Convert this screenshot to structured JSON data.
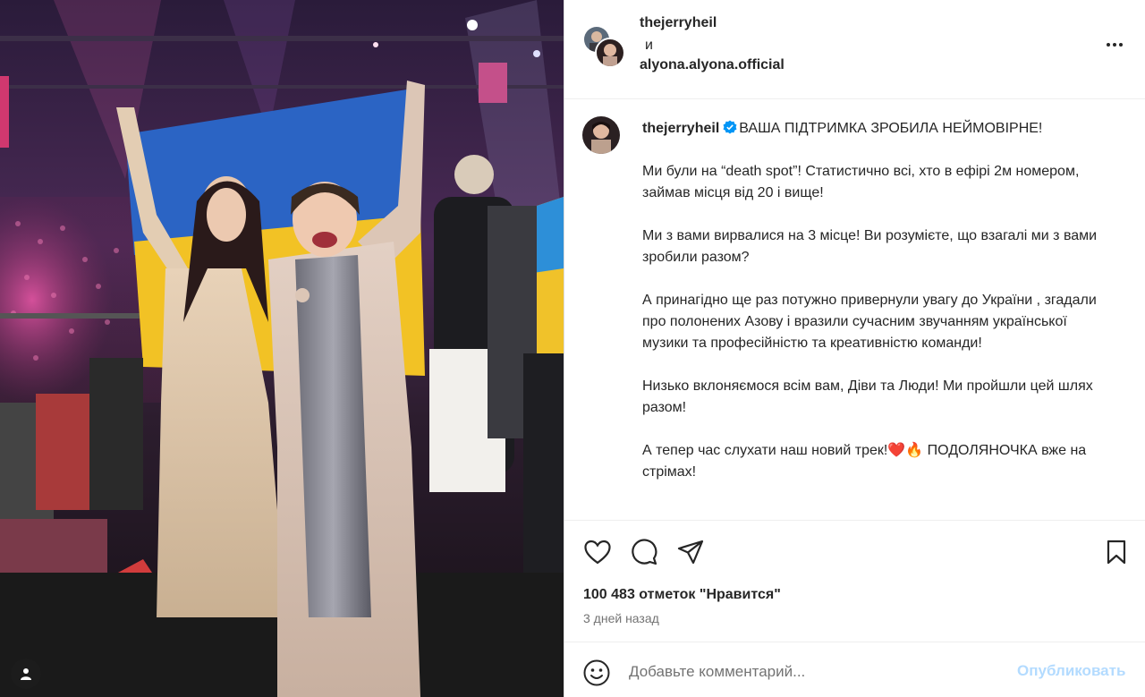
{
  "post": {
    "author": "thejerryheil",
    "and": "и",
    "collaborator": "alyona.alyona.official",
    "verified_icon": "verified-badge-icon",
    "more_icon": "more-options-icon"
  },
  "caption": {
    "username": "thejerryheil",
    "headline": "ВАША ПІДТРИМКА ЗРОБИЛА НЕЙМОВІРНЕ!",
    "paragraphs": [
      "Ми були на “death spot”! Статистично всі, хто в ефірі 2м номером, займав місця від 20 і вище!",
      "Ми з вами вирвалися на 3 місце! Ви розумієте, що взагалі ми з вами зробили разом?",
      "А принагідно ще раз потужно привернули увагу до України , згадали про полонених Азову і вразили сучасним звучанням української музики та професійністю та креативністю команди!",
      "Низько вклоняємося всім вам, Діви та Люди! Ми пройшли цей шлях разом!"
    ],
    "last_before": "А тепер час слухати наш новий трек!",
    "last_emojis": "❤️🔥",
    "last_after": " ПОДОЛЯНОЧКА вже на стрімах!",
    "divider": "_____"
  },
  "actions": {
    "like_icon": "heart-icon",
    "comment_icon": "comment-icon",
    "share_icon": "share-icon",
    "save_icon": "bookmark-icon",
    "likes_text": "100 483 отметок \"Нравится\"",
    "time_ago": "3 дней назад"
  },
  "comment": {
    "placeholder": "Добавьте комментарий...",
    "post_label": "Опубликовать",
    "emoji_icon": "emoji-icon"
  },
  "photo": {
    "tagged_icon": "user-tag-icon"
  },
  "colors": {
    "text": "#262626",
    "secondary": "#737373",
    "link_disabled": "#b3dbff",
    "verified": "#0095f6",
    "border": "#efefef"
  }
}
